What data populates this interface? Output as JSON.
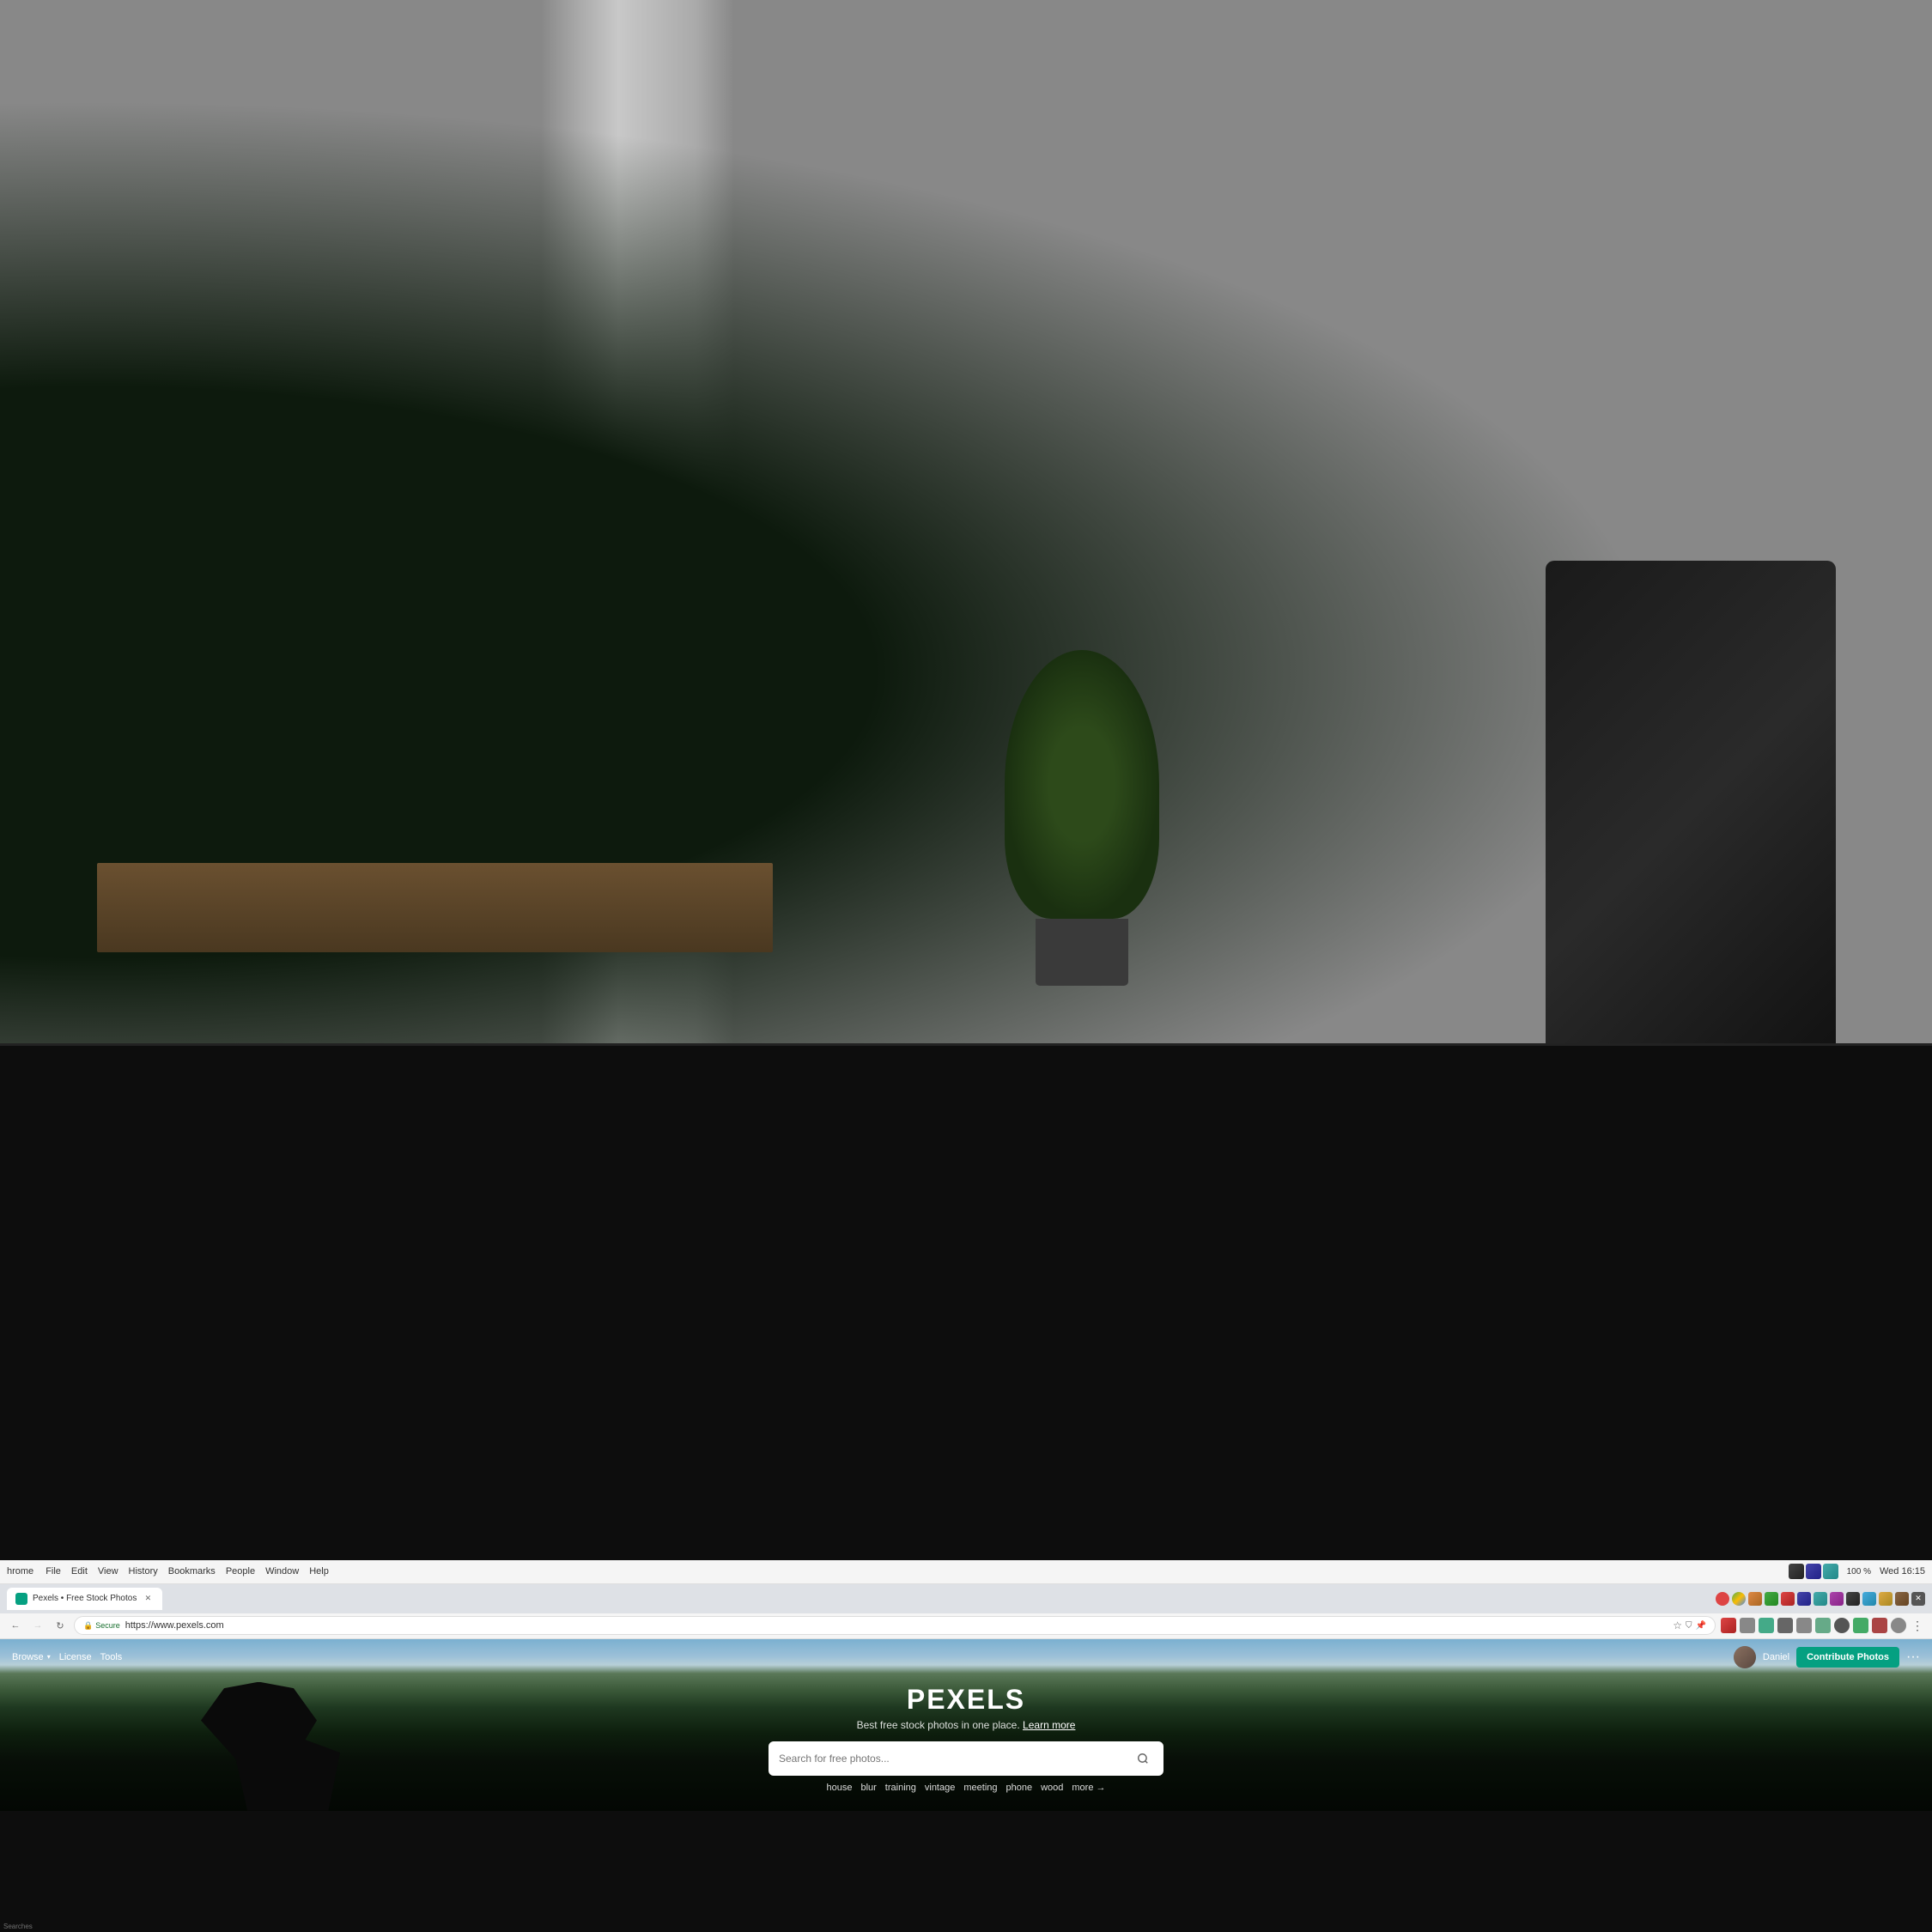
{
  "photo": {
    "description": "Office background photo with bright window light and green plant",
    "alt": "Modern office interior with bright windows and plants"
  },
  "chrome": {
    "os_bar": {
      "app_name": "hrome",
      "menu_items": [
        "File",
        "Edit",
        "View",
        "History",
        "Bookmarks",
        "People",
        "Window",
        "Help"
      ],
      "clock": "Wed 16:15",
      "battery": "100 %"
    },
    "tab": {
      "label": "Pexels • Free Stock Photos"
    },
    "address_bar": {
      "secure_label": "Secure",
      "url": "https://www.pexels.com"
    }
  },
  "pexels": {
    "nav": {
      "browse_label": "Browse",
      "license_label": "License",
      "tools_label": "Tools",
      "user_name": "Daniel",
      "contribute_label": "Contribute Photos",
      "more_label": "···"
    },
    "hero": {
      "title": "PEXELS",
      "subtitle": "Best free stock photos in one place.",
      "learn_more": "Learn more",
      "search_placeholder": "Search for free photos..."
    },
    "suggestions": {
      "tags": [
        "house",
        "blur",
        "training",
        "vintage",
        "meeting",
        "phone",
        "wood"
      ],
      "more_label": "more →"
    }
  },
  "bottom_label": "Searches"
}
